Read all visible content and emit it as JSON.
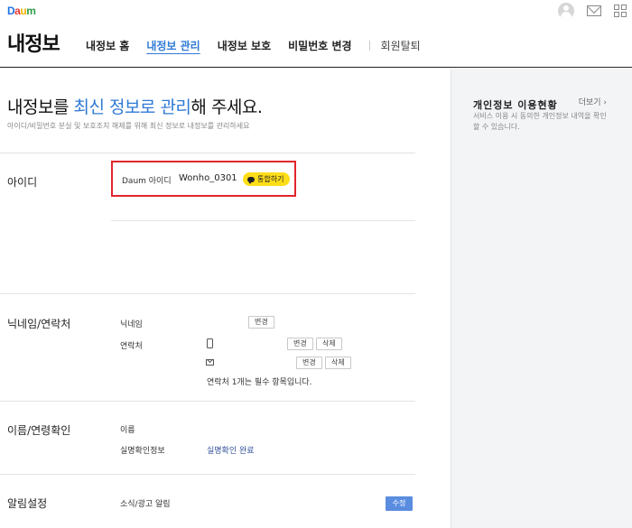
{
  "header": {
    "logo": "Daum",
    "page_title": "내정보",
    "icons": [
      "avatar-icon",
      "mail-icon",
      "apps-grid-icon"
    ],
    "tabs": [
      {
        "label": "내정보 홈",
        "active": false
      },
      {
        "label": "내정보 관리",
        "active": true
      },
      {
        "label": "내정보 보호",
        "active": false
      },
      {
        "label": "비밀번호 변경",
        "active": false
      }
    ],
    "withdraw_label": "회원탈퇴"
  },
  "hero": {
    "title_pre": "내정보를 ",
    "title_highlight": "최신 정보로 관리",
    "title_post": "해 주세요.",
    "subtitle": "아이디/비밀번호 분실 및 보호조치 해제를 위해 최신 정보로 내정보를 관리하세요"
  },
  "id_section": {
    "label": "아이디",
    "id_label": "Daum 아이디",
    "id_value": "Wonho_0301",
    "integrate_label": "통합하기"
  },
  "contact_section": {
    "label": "닉네임/연락처",
    "nickname_label": "닉네임",
    "contact_label": "연락처",
    "change_label": "변경",
    "delete_label": "삭제",
    "required_note": "연락처 1개는 필수 항목입니다."
  },
  "name_section": {
    "label": "이름/연령확인",
    "name_label": "이름",
    "verify_label": "실명확인정보",
    "verify_value": "실명확인 완료"
  },
  "alert_section": {
    "label": "알림설정",
    "news_label": "소식/광고 알림",
    "edit_label": "수정"
  },
  "side_panel": {
    "title": "개인정보 이용현황",
    "more_label": "더보기 ›",
    "description": "서비스 이용 시 동의한 개인정보 내역을 확인할 수 있습니다."
  },
  "colors": {
    "accent_blue": "#2f7ad6",
    "highlight_red": "#e2252b",
    "kakao_yellow": "#ffde18",
    "button_blue": "#5a8de0"
  }
}
